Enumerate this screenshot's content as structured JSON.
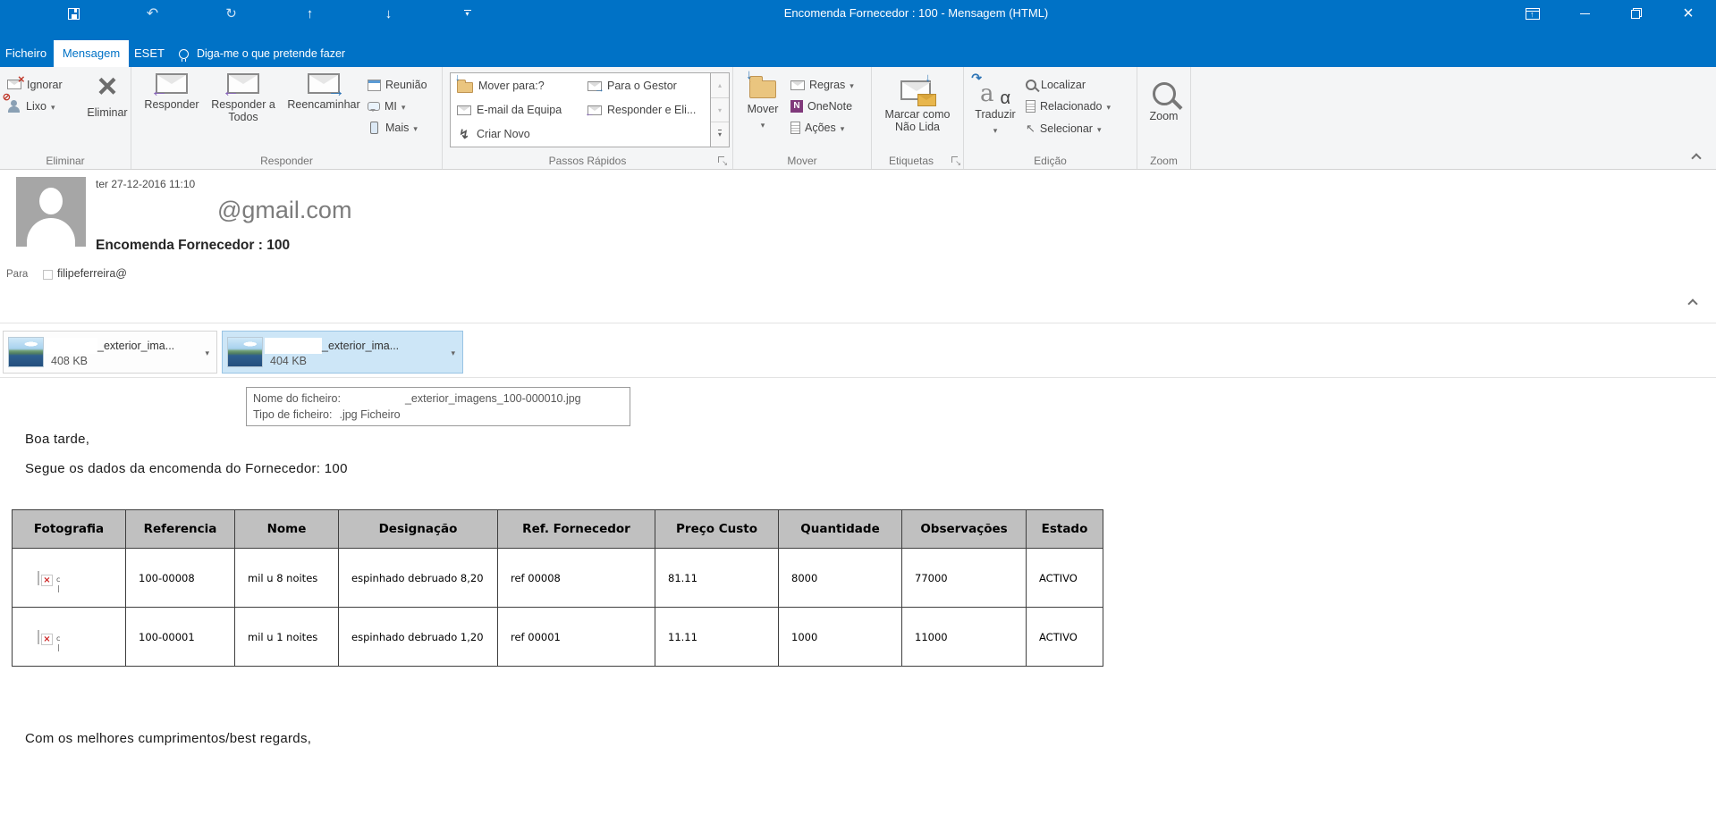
{
  "titlebar": {
    "title": "Encomenda Fornecedor : 100  -  Mensagem (HTML)"
  },
  "tabs": {
    "ficheiro": "Ficheiro",
    "mensagem": "Mensagem",
    "eset": "ESET",
    "tellme": "Diga-me o que pretende fazer"
  },
  "ribbon": {
    "ignorar": "Ignorar",
    "lixo": "Lixo",
    "eliminar": "Eliminar",
    "eliminar_group": "Eliminar",
    "responder": "Responder",
    "responder_todos": "Responder a Todos",
    "reencaminhar": "Reencaminhar",
    "reuniao": "Reunião",
    "mi": "MI",
    "mais": "Mais",
    "responder_group": "Responder",
    "passos": {
      "mover_para": "Mover para:?",
      "para_gestor": "Para o Gestor",
      "email_equipa": "E-mail da Equipa",
      "responder_eli": "Responder e Eli...",
      "criar_novo": "Criar Novo",
      "group": "Passos Rápidos"
    },
    "mover": "Mover",
    "regras": "Regras",
    "onenote": "OneNote",
    "acoes": "Ações",
    "mover_group": "Mover",
    "marcar_line1": "Marcar como",
    "marcar_line2": "Não Lida",
    "etiquetas_group": "Etiquetas",
    "traduzir": "Traduzir",
    "localizar": "Localizar",
    "relacionado": "Relacionado",
    "selecionar": "Selecionar",
    "edicao_group": "Edição",
    "zoom": "Zoom",
    "zoom_group": "Zoom"
  },
  "message": {
    "sent": "ter 27-12-2016 11:10",
    "sender": "@gmail.com",
    "subject": "Encomenda Fornecedor : 100",
    "to_label": "Para",
    "recipient": "filipeferreira@"
  },
  "attachments": [
    {
      "name": "_exterior_ima...",
      "size": "408 KB"
    },
    {
      "name": "_exterior_ima...",
      "size": "404 KB"
    }
  ],
  "tooltip": {
    "name_label": "Nome do ficheiro:",
    "name_value": "_exterior_imagens_100-000010.jpg",
    "type_label": "Tipo de ficheiro:",
    "type_value": ".jpg Ficheiro"
  },
  "body": {
    "greeting": "Boa tarde,",
    "intro": "Segue os dados da encomenda do Fornecedor: 100",
    "closing": "Com os melhores cumprimentos/best regards,"
  },
  "table": {
    "headers": [
      "Fotografia",
      "Referencia",
      "Nome",
      "Designação",
      "Ref. Fornecedor",
      "Preço Custo",
      "Quantidade",
      "Observações",
      "Estado"
    ],
    "rows": [
      {
        "referencia": "100-00008",
        "nome": "mil u 8 noites",
        "designacao": "espinhado debruado 8,20",
        "ref_fornecedor": "ref 00008",
        "preco_custo": "81.11",
        "quantidade": "8000",
        "observacoes": "77000",
        "estado": "ACTIVO"
      },
      {
        "referencia": "100-00001",
        "nome": "mil u 1 noites",
        "designacao": "espinhado debruado 1,20",
        "ref_fornecedor": "ref 00001",
        "preco_custo": "11.11",
        "quantidade": "1000",
        "observacoes": "11000",
        "estado": "ACTIVO"
      }
    ]
  },
  "colors": {
    "titlebar_blue": "#0072c6",
    "accent_blue": "#0072c6",
    "selected_attachment": "#cde6f7",
    "table_header_bg": "#c0c0c0",
    "reply_arrow_purple": "#8764b8",
    "forward_arrow_blue": "#2e75b6"
  }
}
